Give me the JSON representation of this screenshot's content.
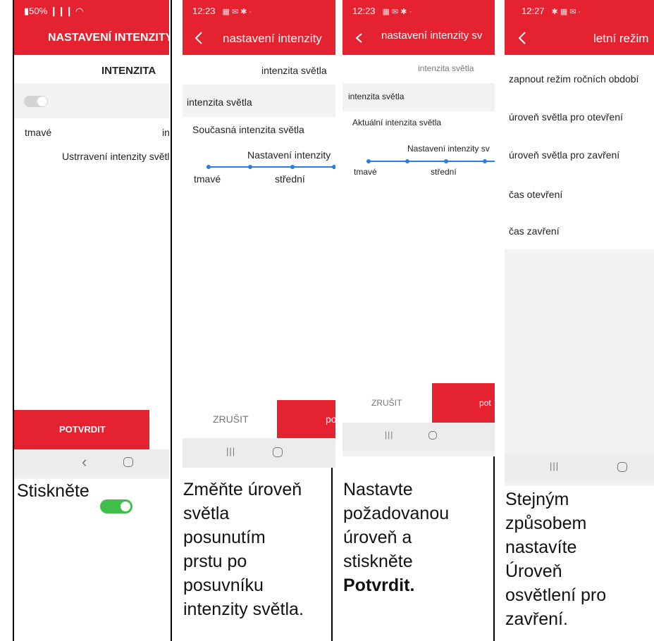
{
  "colors": {
    "brand_red": "#e52230",
    "toggle_green": "#3fbf4a",
    "slider_blue": "#2a7de1"
  },
  "panel1": {
    "status": "▮50% ❙❙❙ ◠",
    "title": "NASTAVENÍ INTENZITY S",
    "heading": "INTENZITA",
    "label_left": "tmavé",
    "label_right": "in",
    "subtitle": "Ustrravení intenzity světl",
    "confirm": "POTVRDIT",
    "nav_back": "‹"
  },
  "panel2": {
    "status": "12:23",
    "title": "nastavení intenzity",
    "header_value": "intenzita světla",
    "row1": "intenzita světla",
    "row2": "Současná intenzita světla",
    "slider_title": "Nastavení intenzity",
    "slider_left": "tmavé",
    "slider_mid": "střední",
    "cancel": "ZRUŠIT",
    "confirm": "po",
    "nav_recent": "|||"
  },
  "panel3": {
    "status": "12:23",
    "title": "nastavení intenzity sv",
    "header_value": "intenzita světla",
    "row1": "intenzita světla",
    "row2": "Aktuální intenzita světla",
    "slider_title": "Nastavení intenzity sv",
    "slider_left": "tmavé",
    "slider_mid": "střední",
    "cancel": "ZRUŠIT",
    "confirm": "pot",
    "nav_recent": "|||"
  },
  "panel4": {
    "status": "12:27",
    "title": "letní režim",
    "rows": [
      "zapnout režim ročních období",
      "úroveň světla pro otevření",
      "úroveň světla pro zavření",
      "čas otevření",
      "čas zavření"
    ],
    "nav_recent": "|||"
  },
  "captions": {
    "c1": "Stiskněte",
    "c2_lines": [
      "Změňte úroveň",
      "světla",
      "posunutím",
      "prstu po",
      "posuvníku",
      "intenzity světla."
    ],
    "c3_lines": [
      "Nastavte",
      "požadovanou",
      "úroveň a",
      "stiskněte"
    ],
    "c3_bold": "Potvrdit.",
    "c4_lines": [
      "Stejným",
      "způsobem",
      "nastavíte",
      "Úroveň",
      "osvětlení pro",
      "zavření."
    ]
  }
}
